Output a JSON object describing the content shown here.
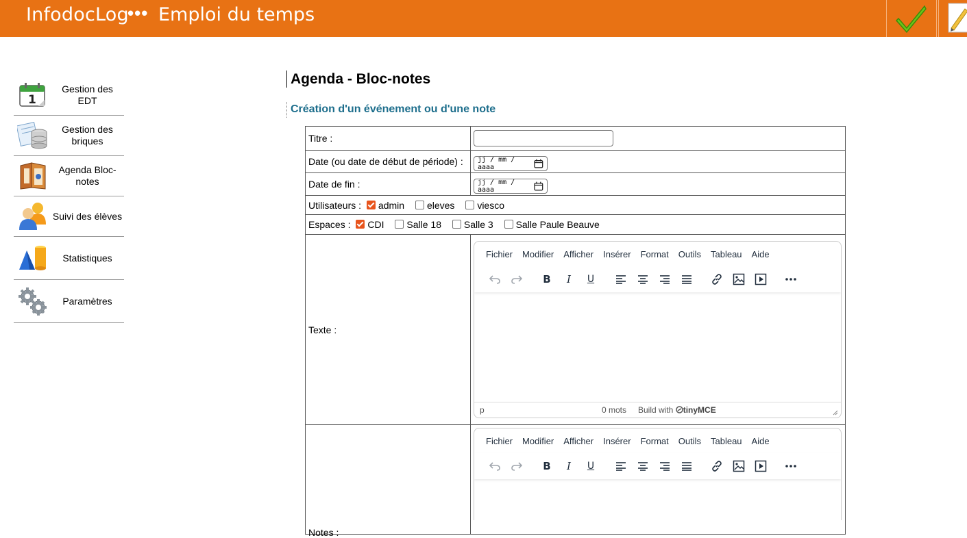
{
  "topbar": {
    "brand": "InfodocLog",
    "dots": "•••",
    "section": "Emploi du temps",
    "buttons": [
      {
        "name": "validate",
        "icon": "checkmark-icon"
      },
      {
        "name": "edit",
        "icon": "pencil-icon"
      }
    ],
    "bg_color": "#e87214"
  },
  "sidebar": {
    "items": [
      {
        "label": "Gestion des EDT",
        "icon": "calendar-icon"
      },
      {
        "label": "Gestion des briques",
        "icon": "database-icon"
      },
      {
        "label": "Agenda Bloc-notes",
        "icon": "agenda-icon"
      },
      {
        "label": "Suivi des élèves",
        "icon": "users-icon"
      },
      {
        "label": "Statistiques",
        "icon": "shapes-icon"
      },
      {
        "label": "Paramètres",
        "icon": "gears-icon"
      }
    ]
  },
  "main": {
    "title": "Agenda - Bloc-notes",
    "subtitle": "Création d'un événement ou d'une note",
    "form": {
      "titre_label": "Titre :",
      "titre_value": "",
      "date_label": "Date (ou date de début de période) :",
      "date_placeholder": "jj / mm / aaaa",
      "date_fin_label": "Date de fin :",
      "date_fin_placeholder": "jj / mm / aaaa",
      "utilisateurs_label": "Utilisateurs :",
      "utilisateurs": [
        {
          "label": "admin",
          "checked": true
        },
        {
          "label": "eleves",
          "checked": false
        },
        {
          "label": "viesco",
          "checked": false
        }
      ],
      "espaces_label": "Espaces :",
      "espaces": [
        {
          "label": "CDI",
          "checked": true
        },
        {
          "label": "Salle 18",
          "checked": false
        },
        {
          "label": "Salle 3",
          "checked": false
        },
        {
          "label": "Salle Paule Beauve",
          "checked": false
        }
      ],
      "texte_label": "Texte :",
      "notes_label": "Notes :"
    },
    "editor": {
      "menus": [
        "Fichier",
        "Modifier",
        "Afficher",
        "Insérer",
        "Format",
        "Outils",
        "Tableau",
        "Aide"
      ],
      "tools": [
        "undo-icon",
        "redo-icon",
        "bold-icon",
        "italic-icon",
        "underline-icon",
        "align-left-icon",
        "align-center-icon",
        "align-right-icon",
        "align-justify-icon",
        "link-icon",
        "image-icon",
        "media-icon",
        "more-icon"
      ],
      "status_path": "p",
      "word_count": "0 mots",
      "build_with": "Build with",
      "brand": "tinyMCE"
    }
  }
}
